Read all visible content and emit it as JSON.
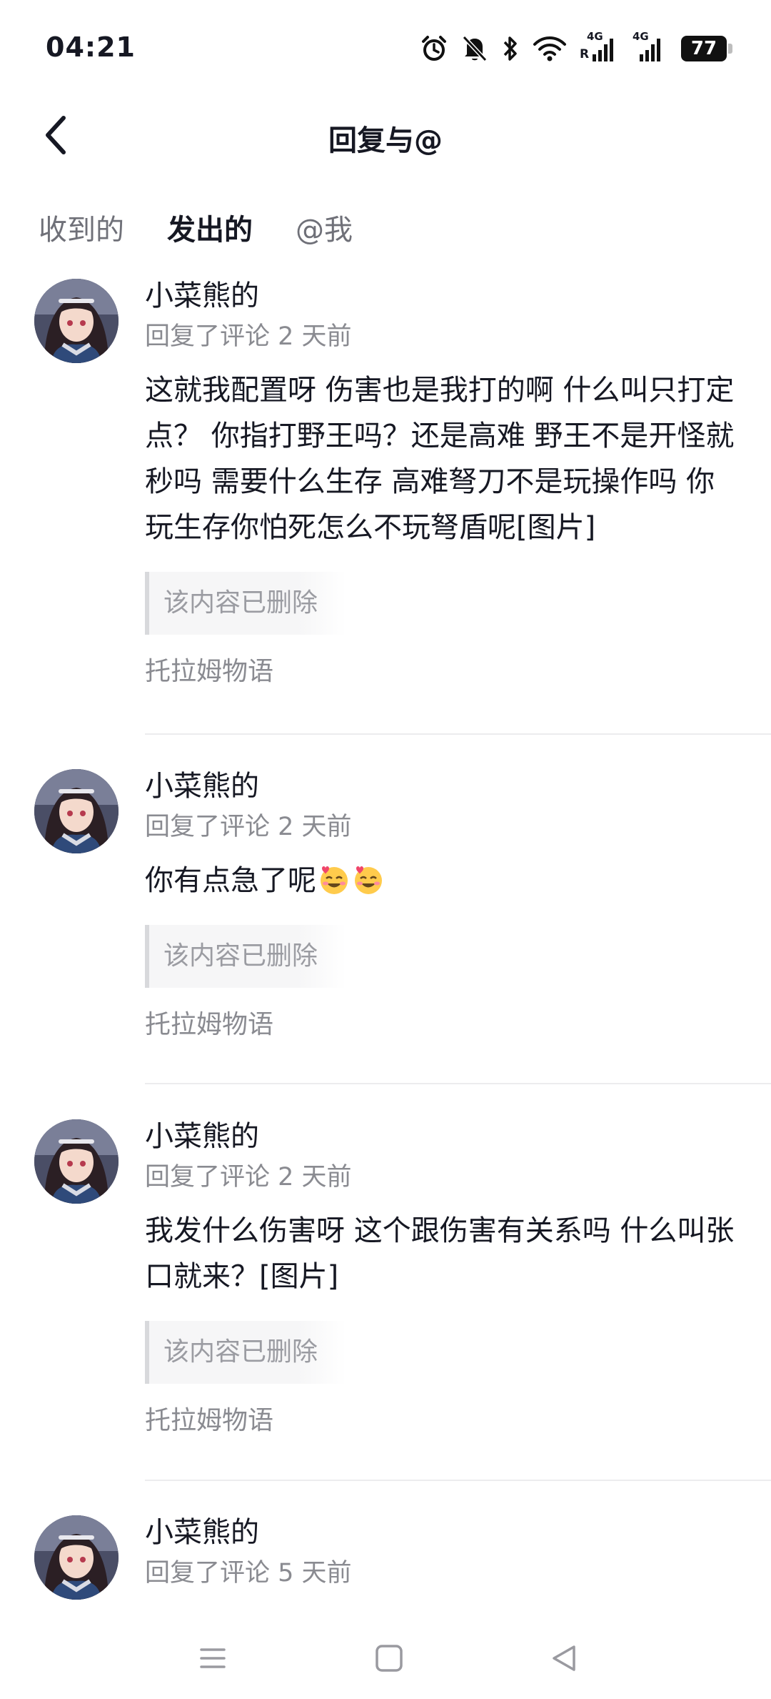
{
  "status_bar": {
    "time": "04:21",
    "battery": "77",
    "network_1": "4G",
    "network_2": "4G",
    "roaming": "R",
    "icons": [
      "alarm-icon",
      "mute-bell-icon",
      "bluetooth-icon",
      "wifi-icon",
      "signal-4g-r-icon",
      "signal-4g-icon",
      "battery-icon"
    ]
  },
  "header": {
    "title": "回复与@",
    "back_icon": "chevron-left-icon"
  },
  "tabs": [
    {
      "label": "收到的",
      "active": false
    },
    {
      "label": "发出的",
      "active": true
    },
    {
      "label": "@我",
      "active": false
    }
  ],
  "comments": [
    {
      "user": "小菜熊的",
      "meta": "回复了评论 2 天前",
      "text": "这就我配置呀 伤害也是我打的啊 什么叫只打定点？ 你指打野王吗？还是高难 野王不是开怪就秒吗 需要什么生存 高难弩刀不是玩操作吗 你玩生存你怕死怎么不玩弩盾呢[图片]",
      "quote": "该内容已删除",
      "source": "托拉姆物语"
    },
    {
      "user": "小菜熊的",
      "meta": "回复了评论 2 天前",
      "text": "你有点急了呢",
      "emoji": [
        "blush-hearts-emoji",
        "blush-hearts-emoji"
      ],
      "quote": "该内容已删除",
      "source": "托拉姆物语"
    },
    {
      "user": "小菜熊的",
      "meta": "回复了评论 2 天前",
      "text": "我发什么伤害呀 这个跟伤害有关系吗 什么叫张口就来？[图片]",
      "quote": "该内容已删除",
      "source": "托拉姆物语"
    },
    {
      "user": "小菜熊的",
      "meta": "回复了评论 5 天前"
    }
  ],
  "nav_bar": {
    "icons": [
      "menu-icon",
      "home-square-icon",
      "back-triangle-icon"
    ]
  },
  "colors": {
    "accent": "#20d5c4",
    "text_primary": "#161823",
    "text_secondary": "#8a8b91"
  }
}
